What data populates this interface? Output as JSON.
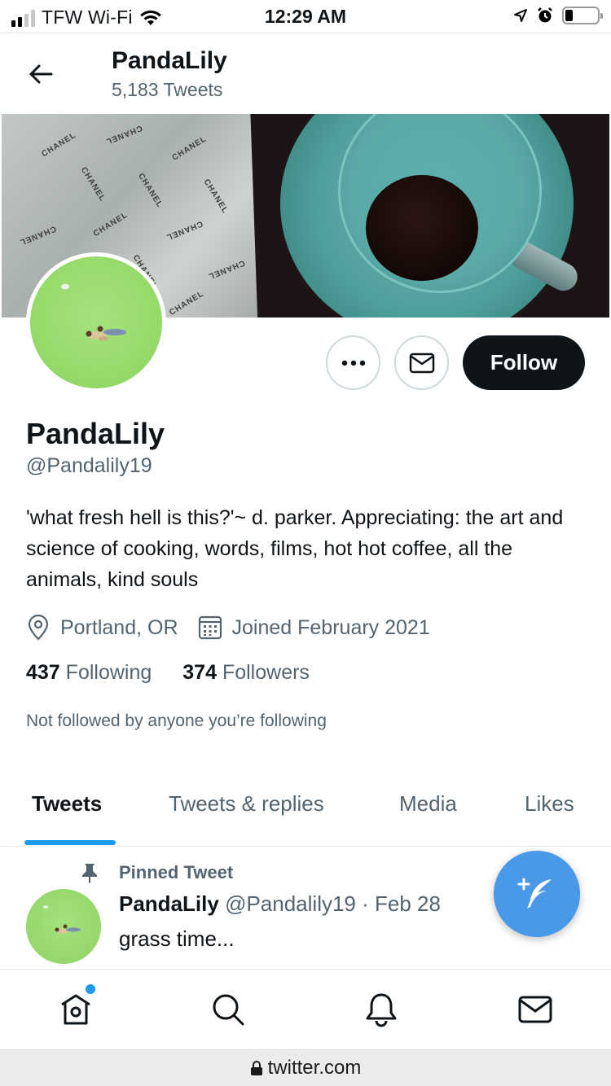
{
  "status_bar": {
    "carrier": "TFW Wi-Fi",
    "time": "12:29 AM",
    "icons": [
      "signal-icon",
      "wifi-icon",
      "location-icon",
      "alarm-icon",
      "battery-icon"
    ],
    "battery_level": 0.2
  },
  "header": {
    "name": "PandaLily",
    "tweet_count": "5,183 Tweets",
    "back_icon": "back-arrow-icon"
  },
  "banner": {
    "paper_text": "CHANEL"
  },
  "actions": {
    "more_icon": "more-icon",
    "message_icon": "mail-icon",
    "follow_label": "Follow"
  },
  "profile": {
    "display_name": "PandaLily",
    "handle": "@Pandalily19",
    "bio": "'what fresh hell is this?'~ d. parker. Appreciating: the art and science of cooking, words, films, hot hot coffee, all the animals, kind souls",
    "location": "Portland, OR",
    "joined": "Joined February 2021",
    "following_count": "437",
    "following_label": "Following",
    "followers_count": "374",
    "followers_label": "Followers",
    "followed_note": "Not followed by anyone you’re following"
  },
  "tabs": [
    {
      "label": "Tweets",
      "active": true
    },
    {
      "label": "Tweets & replies",
      "active": false
    },
    {
      "label": "Media",
      "active": false
    },
    {
      "label": "Likes",
      "active": false
    }
  ],
  "pinned_tweet": {
    "pin_label": "Pinned Tweet",
    "name": "PandaLily",
    "handle_date": "@Pandalily19 · Feb 28",
    "text": "grass time..."
  },
  "fab": {
    "icon": "compose-tweet-icon"
  },
  "bottom_nav": {
    "items": [
      "home-icon",
      "search-icon",
      "notifications-icon",
      "messages-icon"
    ]
  },
  "url_bar": {
    "url": "twitter.com"
  },
  "colors": {
    "accent": "#1d9bf0",
    "fab": "#4a99e9",
    "text_primary": "#0f1419",
    "text_secondary": "#536471",
    "follow_bg": "#0f1419"
  }
}
